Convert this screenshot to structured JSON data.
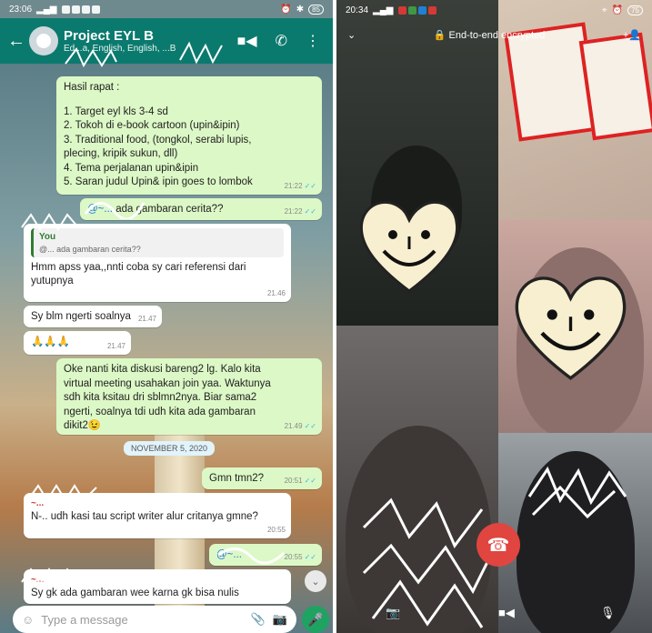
{
  "left": {
    "status_bar": {
      "time": "23:06",
      "battery": "85"
    },
    "header": {
      "title": "Project EYL B",
      "subtitle": "Ed...a, English, English, ...B",
      "icons": [
        "video-call-icon",
        "phone-icon",
        "more-icon"
      ]
    },
    "messages": [
      {
        "type": "out",
        "lines": [
          "Hasil rapat :",
          "",
          "1. Target eyl kls 3-4 sd",
          "2. Tokoh di e-book cartoon (upin&ipin)",
          "3. Traditional food, (tongkol, serabi lupis,",
          "plecing, kripik sukun, dll)",
          "4. Tema perjalanan upin&ipin",
          "5. Saran judul Upin& ipin goes to lombok"
        ],
        "time": "21:22"
      },
      {
        "type": "out",
        "mention": "@~...",
        "text": "ada gambaran cerita??",
        "time": "21:22"
      },
      {
        "type": "in",
        "sender": "~...",
        "quote_name": "You",
        "quote_text": "@... ada gambaran cerita??",
        "text": "Hmm apss yaa,,nnti coba sy cari referensi dari yutupnya",
        "time": "21.46"
      },
      {
        "type": "in",
        "text": "Sy blm ngerti soalnya",
        "time": "21.47"
      },
      {
        "type": "in",
        "text": "🙏🙏🙏",
        "time": "21.47"
      },
      {
        "type": "out",
        "lines": [
          "Oke nanti kita diskusi bareng2 lg. Kalo kita",
          "virtual meeting usahakan join yaa. Waktunya",
          "sdh kita ksitau dri sblmn2nya. Biar sama2",
          "ngerti, soalnya tdi udh kita ada gambaran",
          "dikit2😉"
        ],
        "time": "21.49"
      },
      {
        "type": "out",
        "text": "Gmn tmn2?",
        "time": "20:51"
      },
      {
        "type": "in",
        "sender": "~...",
        "text": "N-.. udh kasi tau script writer alur critanya gmne?",
        "time": "20:55"
      },
      {
        "type": "out",
        "mention": "@~...",
        "text": "",
        "time": "20:55"
      },
      {
        "type": "in",
        "sender": "~...",
        "text": "Sy gk ada gambaran wee karna gk bisa nulis",
        "time": ""
      }
    ],
    "date_chip": "NOVEMBER 5, 2020",
    "input": {
      "placeholder": "Type a message"
    }
  },
  "right": {
    "status_bar": {
      "time": "20:34",
      "battery": "75"
    },
    "call_header": {
      "encrypted_label": "End-to-end encrypted"
    }
  },
  "colors": {
    "header": "#0b7a6e",
    "outgoing": "#dcf8c6",
    "incoming": "#ffffff",
    "end_call": "#e0453f",
    "send": "#1ea362"
  }
}
